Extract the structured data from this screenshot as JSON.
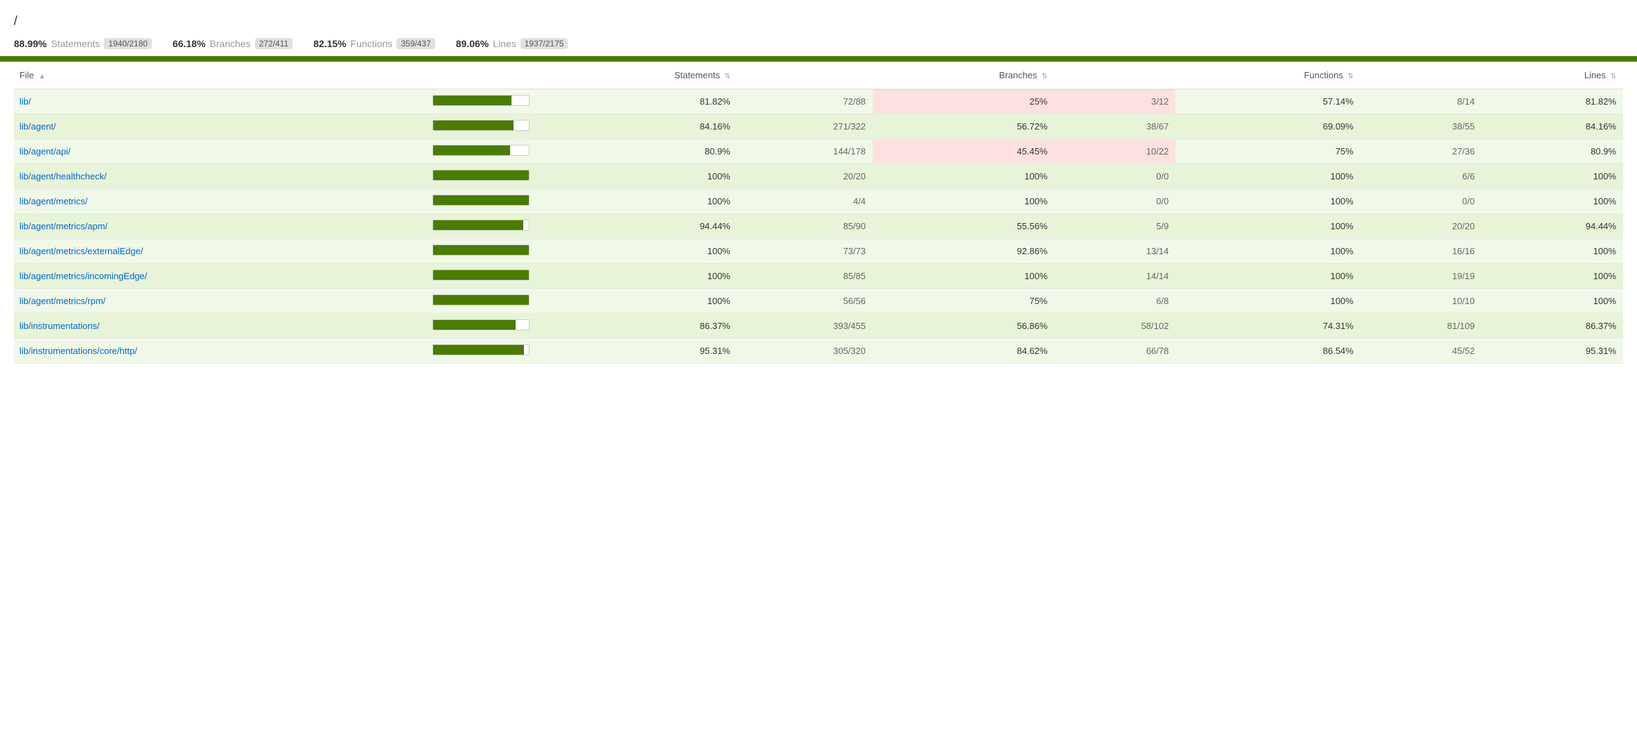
{
  "breadcrumb": "/",
  "stats": {
    "statements": {
      "pct": "88.99%",
      "label": "Statements",
      "badge": "1940/2180"
    },
    "branches": {
      "pct": "66.18%",
      "label": "Branches",
      "badge": "272/411"
    },
    "functions": {
      "pct": "82.15%",
      "label": "Functions",
      "badge": "359/437"
    },
    "lines": {
      "pct": "89.06%",
      "label": "Lines",
      "badge": "1937/2175"
    }
  },
  "table": {
    "headers": {
      "file": "File",
      "file_sort": "▲",
      "statements": "Statements",
      "statements_sort": "⇅",
      "branches": "Branches",
      "branches_sort": "⇅",
      "functions": "Functions",
      "functions_sort": "⇅",
      "lines": "Lines",
      "lines_sort": "⇅"
    },
    "rows": [
      {
        "file": "lib/",
        "progress": 81.82,
        "stmt_pct": "81.82%",
        "stmt_ratio": "72/88",
        "branch_pct": "25%",
        "branch_ratio": "3/12",
        "branch_pink": true,
        "func_pct": "57.14%",
        "func_ratio": "8/14",
        "line_pct": "81.82%"
      },
      {
        "file": "lib/agent/",
        "progress": 84.16,
        "stmt_pct": "84.16%",
        "stmt_ratio": "271/322",
        "branch_pct": "56.72%",
        "branch_ratio": "38/67",
        "branch_pink": false,
        "func_pct": "69.09%",
        "func_ratio": "38/55",
        "line_pct": "84.16%"
      },
      {
        "file": "lib/agent/api/",
        "progress": 80.9,
        "stmt_pct": "80.9%",
        "stmt_ratio": "144/178",
        "branch_pct": "45.45%",
        "branch_ratio": "10/22",
        "branch_pink": true,
        "func_pct": "75%",
        "func_ratio": "27/36",
        "line_pct": "80.9%"
      },
      {
        "file": "lib/agent/healthcheck/",
        "progress": 100,
        "stmt_pct": "100%",
        "stmt_ratio": "20/20",
        "branch_pct": "100%",
        "branch_ratio": "0/0",
        "branch_pink": false,
        "func_pct": "100%",
        "func_ratio": "6/6",
        "line_pct": "100%"
      },
      {
        "file": "lib/agent/metrics/",
        "progress": 100,
        "stmt_pct": "100%",
        "stmt_ratio": "4/4",
        "branch_pct": "100%",
        "branch_ratio": "0/0",
        "branch_pink": false,
        "func_pct": "100%",
        "func_ratio": "0/0",
        "line_pct": "100%"
      },
      {
        "file": "lib/agent/metrics/apm/",
        "progress": 94.44,
        "stmt_pct": "94.44%",
        "stmt_ratio": "85/90",
        "branch_pct": "55.56%",
        "branch_ratio": "5/9",
        "branch_pink": false,
        "func_pct": "100%",
        "func_ratio": "20/20",
        "line_pct": "94.44%"
      },
      {
        "file": "lib/agent/metrics/externalEdge/",
        "progress": 100,
        "stmt_pct": "100%",
        "stmt_ratio": "73/73",
        "branch_pct": "92.86%",
        "branch_ratio": "13/14",
        "branch_pink": false,
        "func_pct": "100%",
        "func_ratio": "16/16",
        "line_pct": "100%"
      },
      {
        "file": "lib/agent/metrics/incomingEdge/",
        "progress": 100,
        "stmt_pct": "100%",
        "stmt_ratio": "85/85",
        "branch_pct": "100%",
        "branch_ratio": "14/14",
        "branch_pink": false,
        "func_pct": "100%",
        "func_ratio": "19/19",
        "line_pct": "100%"
      },
      {
        "file": "lib/agent/metrics/rpm/",
        "progress": 100,
        "stmt_pct": "100%",
        "stmt_ratio": "56/56",
        "branch_pct": "75%",
        "branch_ratio": "6/8",
        "branch_pink": false,
        "func_pct": "100%",
        "func_ratio": "10/10",
        "line_pct": "100%"
      },
      {
        "file": "lib/instrumentations/",
        "progress": 86.37,
        "stmt_pct": "86.37%",
        "stmt_ratio": "393/455",
        "branch_pct": "56.86%",
        "branch_ratio": "58/102",
        "branch_pink": false,
        "func_pct": "74.31%",
        "func_ratio": "81/109",
        "line_pct": "86.37%"
      },
      {
        "file": "lib/instrumentations/core/http/",
        "progress": 95.31,
        "stmt_pct": "95.31%",
        "stmt_ratio": "305/320",
        "branch_pct": "84.62%",
        "branch_ratio": "66/78",
        "branch_pink": false,
        "func_pct": "86.54%",
        "func_ratio": "45/52",
        "line_pct": "95.31%"
      }
    ]
  }
}
